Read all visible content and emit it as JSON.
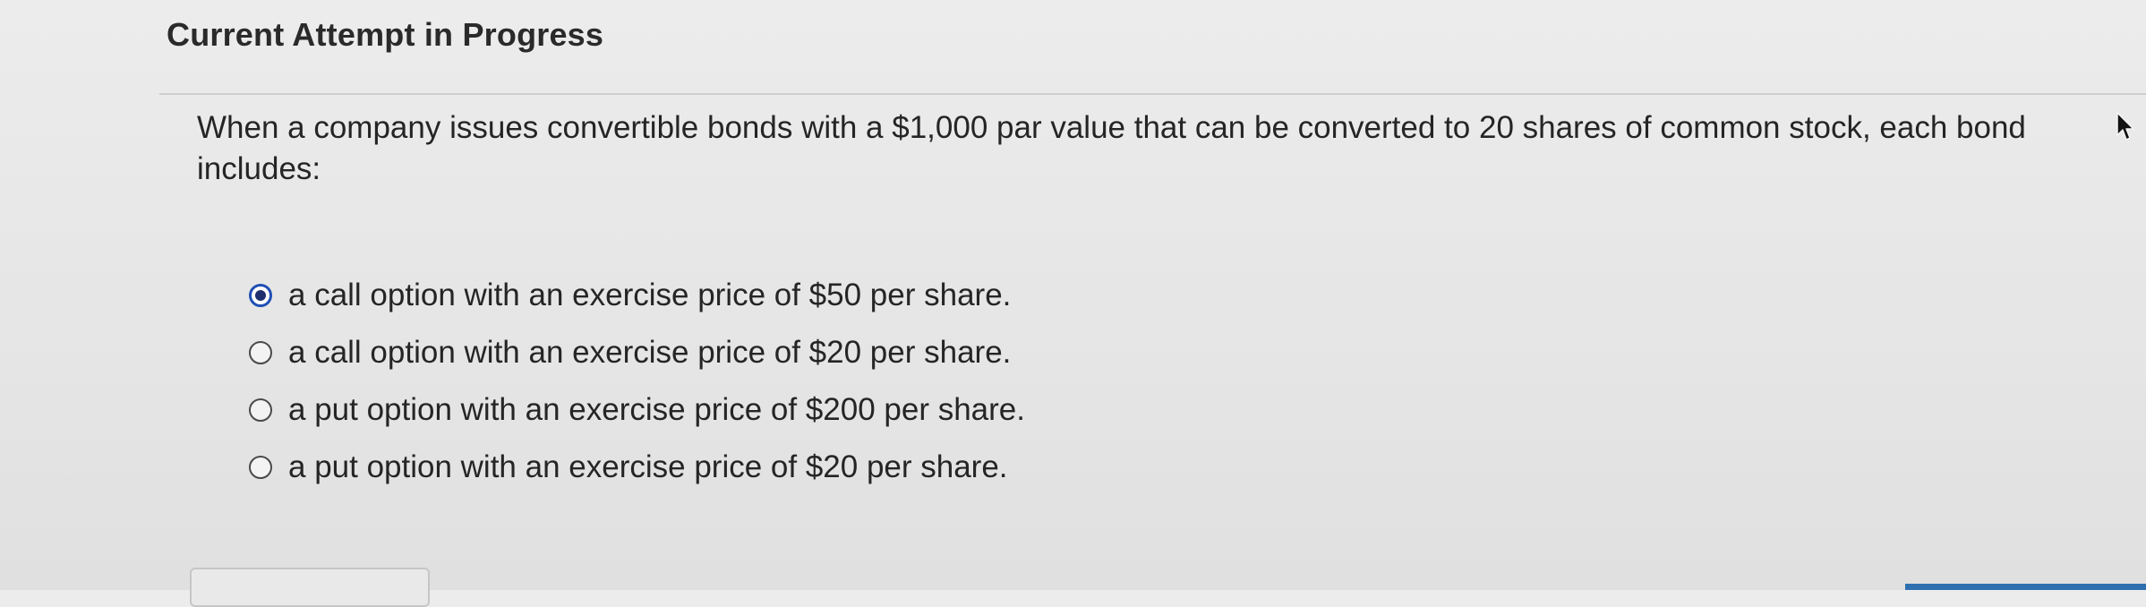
{
  "page": {
    "heading": "Current Attempt in Progress"
  },
  "question": {
    "text": "When a company issues convertible bonds with a $1,000 par value that can be converted to 20 shares of common stock, each bond includes:"
  },
  "options": [
    {
      "label": "a call option with an exercise price of $50 per share.",
      "selected": true
    },
    {
      "label": "a call option with an exercise price of $20 per share.",
      "selected": false
    },
    {
      "label": "a put option with an exercise price of $200 per share.",
      "selected": false
    },
    {
      "label": "a put option with an exercise price of $20 per share.",
      "selected": false
    }
  ],
  "icons": {
    "cursor": "mouse-pointer-icon"
  },
  "colors": {
    "selected_radio": "#1f4fb5",
    "radio_dot": "#1f2f6e",
    "divider": "#cfcfcf"
  }
}
